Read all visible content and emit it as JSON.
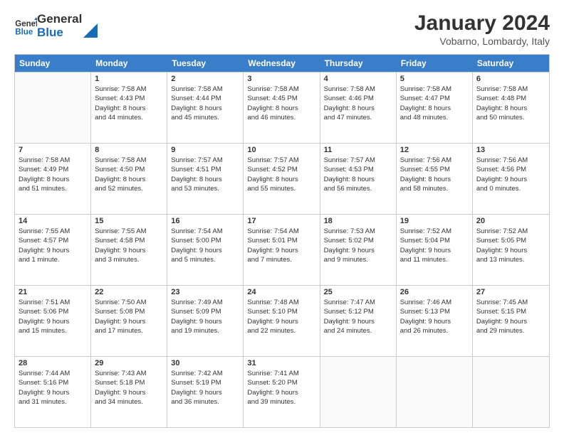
{
  "logo": {
    "general": "General",
    "blue": "Blue"
  },
  "title": "January 2024",
  "subtitle": "Vobarno, Lombardy, Italy",
  "days": [
    "Sunday",
    "Monday",
    "Tuesday",
    "Wednesday",
    "Thursday",
    "Friday",
    "Saturday"
  ],
  "weeks": [
    [
      {
        "day": "",
        "text": ""
      },
      {
        "day": "1",
        "text": "Sunrise: 7:58 AM\nSunset: 4:43 PM\nDaylight: 8 hours\nand 44 minutes."
      },
      {
        "day": "2",
        "text": "Sunrise: 7:58 AM\nSunset: 4:44 PM\nDaylight: 8 hours\nand 45 minutes."
      },
      {
        "day": "3",
        "text": "Sunrise: 7:58 AM\nSunset: 4:45 PM\nDaylight: 8 hours\nand 46 minutes."
      },
      {
        "day": "4",
        "text": "Sunrise: 7:58 AM\nSunset: 4:46 PM\nDaylight: 8 hours\nand 47 minutes."
      },
      {
        "day": "5",
        "text": "Sunrise: 7:58 AM\nSunset: 4:47 PM\nDaylight: 8 hours\nand 48 minutes."
      },
      {
        "day": "6",
        "text": "Sunrise: 7:58 AM\nSunset: 4:48 PM\nDaylight: 8 hours\nand 50 minutes."
      }
    ],
    [
      {
        "day": "7",
        "text": "Sunrise: 7:58 AM\nSunset: 4:49 PM\nDaylight: 8 hours\nand 51 minutes."
      },
      {
        "day": "8",
        "text": "Sunrise: 7:58 AM\nSunset: 4:50 PM\nDaylight: 8 hours\nand 52 minutes."
      },
      {
        "day": "9",
        "text": "Sunrise: 7:57 AM\nSunset: 4:51 PM\nDaylight: 8 hours\nand 53 minutes."
      },
      {
        "day": "10",
        "text": "Sunrise: 7:57 AM\nSunset: 4:52 PM\nDaylight: 8 hours\nand 55 minutes."
      },
      {
        "day": "11",
        "text": "Sunrise: 7:57 AM\nSunset: 4:53 PM\nDaylight: 8 hours\nand 56 minutes."
      },
      {
        "day": "12",
        "text": "Sunrise: 7:56 AM\nSunset: 4:55 PM\nDaylight: 8 hours\nand 58 minutes."
      },
      {
        "day": "13",
        "text": "Sunrise: 7:56 AM\nSunset: 4:56 PM\nDaylight: 9 hours\nand 0 minutes."
      }
    ],
    [
      {
        "day": "14",
        "text": "Sunrise: 7:55 AM\nSunset: 4:57 PM\nDaylight: 9 hours\nand 1 minute."
      },
      {
        "day": "15",
        "text": "Sunrise: 7:55 AM\nSunset: 4:58 PM\nDaylight: 9 hours\nand 3 minutes."
      },
      {
        "day": "16",
        "text": "Sunrise: 7:54 AM\nSunset: 5:00 PM\nDaylight: 9 hours\nand 5 minutes."
      },
      {
        "day": "17",
        "text": "Sunrise: 7:54 AM\nSunset: 5:01 PM\nDaylight: 9 hours\nand 7 minutes."
      },
      {
        "day": "18",
        "text": "Sunrise: 7:53 AM\nSunset: 5:02 PM\nDaylight: 9 hours\nand 9 minutes."
      },
      {
        "day": "19",
        "text": "Sunrise: 7:52 AM\nSunset: 5:04 PM\nDaylight: 9 hours\nand 11 minutes."
      },
      {
        "day": "20",
        "text": "Sunrise: 7:52 AM\nSunset: 5:05 PM\nDaylight: 9 hours\nand 13 minutes."
      }
    ],
    [
      {
        "day": "21",
        "text": "Sunrise: 7:51 AM\nSunset: 5:06 PM\nDaylight: 9 hours\nand 15 minutes."
      },
      {
        "day": "22",
        "text": "Sunrise: 7:50 AM\nSunset: 5:08 PM\nDaylight: 9 hours\nand 17 minutes."
      },
      {
        "day": "23",
        "text": "Sunrise: 7:49 AM\nSunset: 5:09 PM\nDaylight: 9 hours\nand 19 minutes."
      },
      {
        "day": "24",
        "text": "Sunrise: 7:48 AM\nSunset: 5:10 PM\nDaylight: 9 hours\nand 22 minutes."
      },
      {
        "day": "25",
        "text": "Sunrise: 7:47 AM\nSunset: 5:12 PM\nDaylight: 9 hours\nand 24 minutes."
      },
      {
        "day": "26",
        "text": "Sunrise: 7:46 AM\nSunset: 5:13 PM\nDaylight: 9 hours\nand 26 minutes."
      },
      {
        "day": "27",
        "text": "Sunrise: 7:45 AM\nSunset: 5:15 PM\nDaylight: 9 hours\nand 29 minutes."
      }
    ],
    [
      {
        "day": "28",
        "text": "Sunrise: 7:44 AM\nSunset: 5:16 PM\nDaylight: 9 hours\nand 31 minutes."
      },
      {
        "day": "29",
        "text": "Sunrise: 7:43 AM\nSunset: 5:18 PM\nDaylight: 9 hours\nand 34 minutes."
      },
      {
        "day": "30",
        "text": "Sunrise: 7:42 AM\nSunset: 5:19 PM\nDaylight: 9 hours\nand 36 minutes."
      },
      {
        "day": "31",
        "text": "Sunrise: 7:41 AM\nSunset: 5:20 PM\nDaylight: 9 hours\nand 39 minutes."
      },
      {
        "day": "",
        "text": ""
      },
      {
        "day": "",
        "text": ""
      },
      {
        "day": "",
        "text": ""
      }
    ]
  ]
}
